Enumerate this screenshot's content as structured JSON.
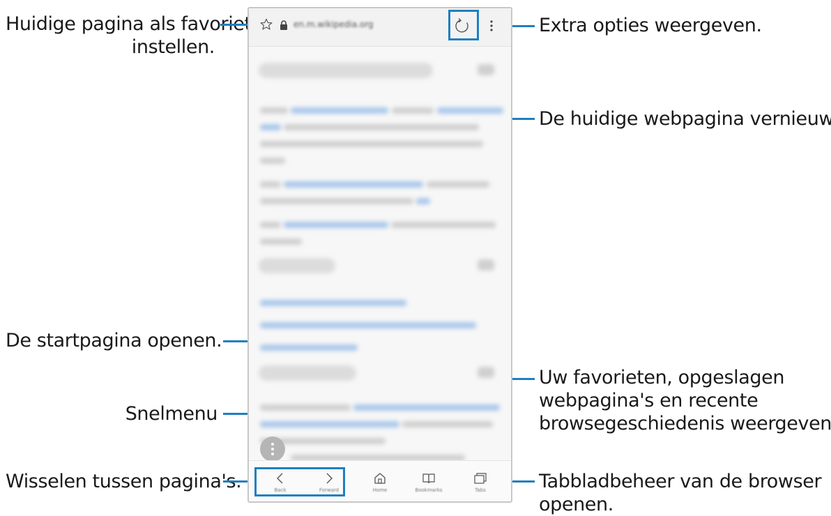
{
  "browser": {
    "url": "en.m.wikipedia.org",
    "icons": {
      "favorite": "star-icon",
      "secure": "lock-icon",
      "refresh": "refresh-icon",
      "more": "more-vertical-icon",
      "quick_menu": "quick-menu-icon",
      "back": "chevron-left-icon",
      "forward": "chevron-right-icon",
      "home": "home-icon",
      "bookmarks": "book-icon",
      "tabs": "tabs-icon"
    },
    "nav": {
      "back_label": "Back",
      "forward_label": "Forward",
      "home_label": "Home",
      "bookmarks_label": "Bookmarks",
      "tabs_label": "Tabs"
    }
  },
  "callouts": {
    "favorite_line1": "Huidige pagina als favoriet",
    "favorite_line2": "instellen.",
    "more_options": "Extra opties weergeven.",
    "refresh": "De huidige webpagina vernieuwen.",
    "homepage": "De startpagina openen.",
    "bookmarks_line1": "Uw favorieten, opgeslagen",
    "bookmarks_line2": "webpagina's en recente",
    "bookmarks_line3": "browsegeschiedenis weergeven.",
    "quick_menu": "Snelmenu",
    "switch_pages": "Wisselen tussen pagina's.",
    "tabs_line1": "Tabbladbeheer van de browser",
    "tabs_line2": "openen."
  },
  "colors": {
    "accent": "#1f7fbf",
    "link_blue": "#a9c7ea"
  }
}
